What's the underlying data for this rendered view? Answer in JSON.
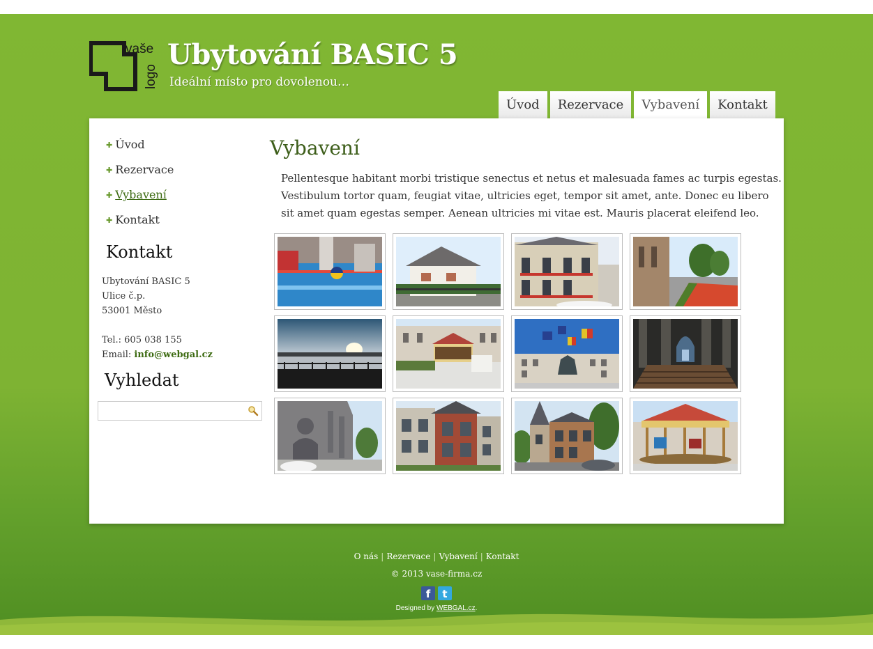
{
  "header": {
    "logo_text": [
      "vaše",
      "logo"
    ],
    "title": "Ubytování BASIC 5",
    "slogan": "Ideální místo pro dovolenou…"
  },
  "tabs": [
    {
      "label": "Úvod",
      "active": false
    },
    {
      "label": "Rezervace",
      "active": false
    },
    {
      "label": "Vybavení",
      "active": true
    },
    {
      "label": "Kontakt",
      "active": false
    }
  ],
  "sidebar": {
    "nav": [
      {
        "label": "Úvod",
        "current": false
      },
      {
        "label": "Rezervace",
        "current": false
      },
      {
        "label": "Vybavení",
        "current": true
      },
      {
        "label": "Kontakt",
        "current": false
      }
    ],
    "contact_heading": "Kontakt",
    "contact": {
      "name": "Ubytování BASIC 5",
      "street": "Ulice č.p.",
      "city": "53001 Město",
      "phone": "Tel.: 605 038 155",
      "email_label": "Email: ",
      "email": "info@webgal.cz"
    },
    "search_heading": "Vyhledat",
    "search_value": "",
    "search_icon": "magnifier-icon"
  },
  "content": {
    "title": "Vybavení",
    "text": "Pellentesque habitant morbi tristique senectus et netus et malesuada fames ac turpis egestas. Vestibulum tortor quam, feugiat vitae, ultricies eget, tempor sit amet, ante. Donec eu libero sit amet quam egestas semper. Aenean ultricies mi vitae est. Mauris placerat eleifend leo.",
    "gallery": [
      {
        "name": "photo-swimming-pool-ball"
      },
      {
        "name": "photo-white-house"
      },
      {
        "name": "photo-stone-townhouse-flowers"
      },
      {
        "name": "photo-street-flowerbed"
      },
      {
        "name": "photo-river-sunset"
      },
      {
        "name": "photo-carousel-square"
      },
      {
        "name": "photo-statue-flags"
      },
      {
        "name": "photo-church-interior"
      },
      {
        "name": "photo-gothic-cathedral"
      },
      {
        "name": "photo-brick-townhouse"
      },
      {
        "name": "photo-turret-building"
      },
      {
        "name": "photo-carousel-closeup"
      }
    ]
  },
  "footer": {
    "links": [
      "O nás",
      "Rezervace",
      "Vybavení",
      "Kontakt"
    ],
    "copyright": "© 2013 vase-firma.cz",
    "social": [
      {
        "icon": "facebook-icon",
        "glyph": "f"
      },
      {
        "icon": "twitter-icon",
        "glyph": "t"
      }
    ],
    "designed_prefix": "Designed by ",
    "designed_link": "WEBGAL.cz",
    "designed_suffix": "."
  },
  "colors": {
    "brand_green": "#80b733",
    "heading_green": "#3d5e1a",
    "link_green": "#3d6b12"
  }
}
